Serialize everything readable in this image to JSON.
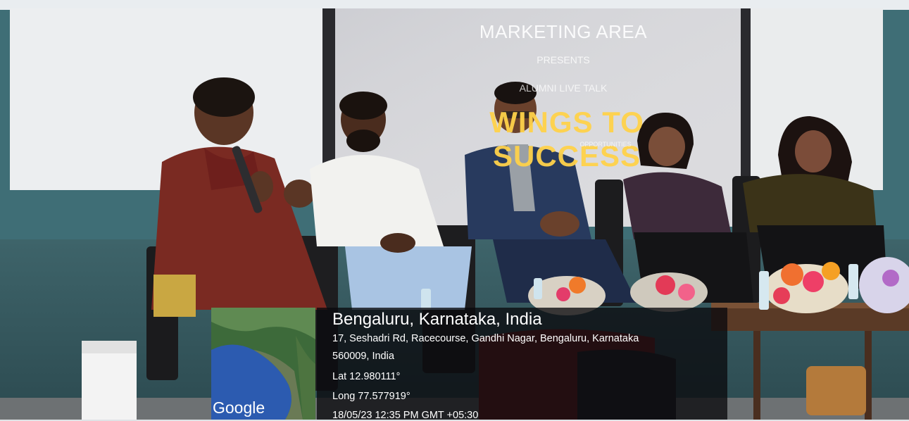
{
  "screen": {
    "title": "MARKETING AREA",
    "subtitle": "PRESENTS",
    "subtitle2": "ALUMNI LIVE TALK",
    "headline": "WINGS TO SUCCESS",
    "tagline": "OPPORTUNITIES"
  },
  "geotag": {
    "map_logo": "Google",
    "city": "Bengaluru, Karnataka, India",
    "address_line1": "17, Seshadri Rd, Racecourse, Gandhi Nagar, Bengaluru, Karnataka",
    "address_line2": "560009, India",
    "lat": "Lat 12.980111°",
    "long": "Long 77.577919°",
    "timestamp": "18/05/23 12:35 PM GMT +05:30"
  },
  "colors": {
    "wall": "#3f6f78",
    "screen": "#d9dadd",
    "headline": "#ffd24a",
    "overlay": "#0a0a0e"
  }
}
